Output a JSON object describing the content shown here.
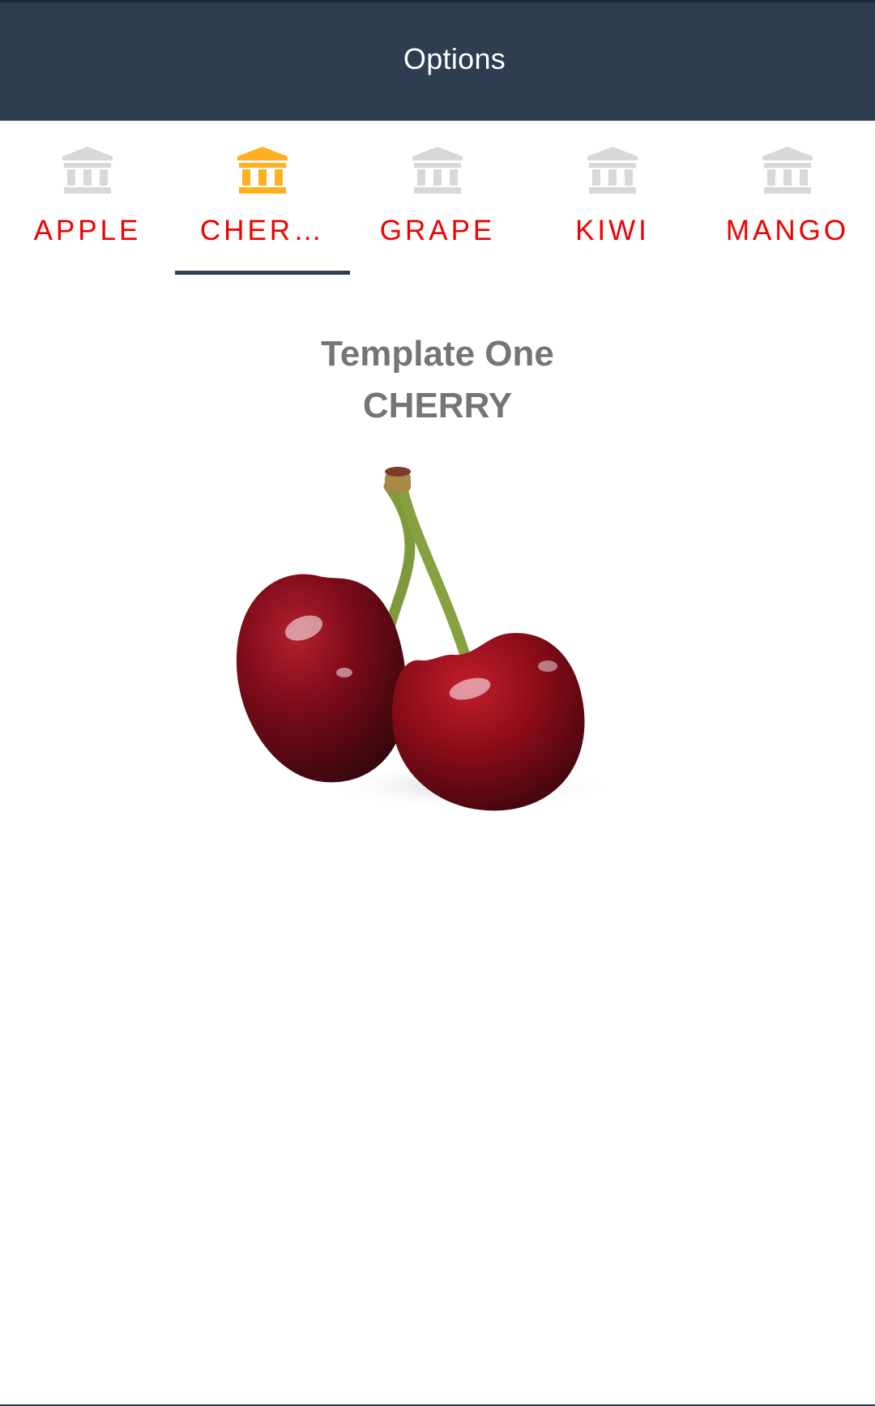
{
  "header": {
    "title": "Options"
  },
  "tabs": [
    {
      "label": "APPLE",
      "icon": "institution-icon",
      "active": false
    },
    {
      "label": "CHER…",
      "icon": "institution-icon",
      "active": true
    },
    {
      "label": "GRAPE",
      "icon": "institution-icon",
      "active": false
    },
    {
      "label": "KIWI",
      "icon": "institution-icon",
      "active": false
    },
    {
      "label": "MANGO",
      "icon": "institution-icon",
      "active": false
    }
  ],
  "content": {
    "template_name": "Template One",
    "fruit_name": "CHERRY",
    "image": "cherry-image"
  },
  "colors": {
    "header_bg": "#2e3d50",
    "tab_label": "#f00000",
    "icon_active": "#ffb020",
    "icon_inactive": "#d8d8d8",
    "heading_text": "#757575",
    "indicator": "#2e3d50"
  }
}
